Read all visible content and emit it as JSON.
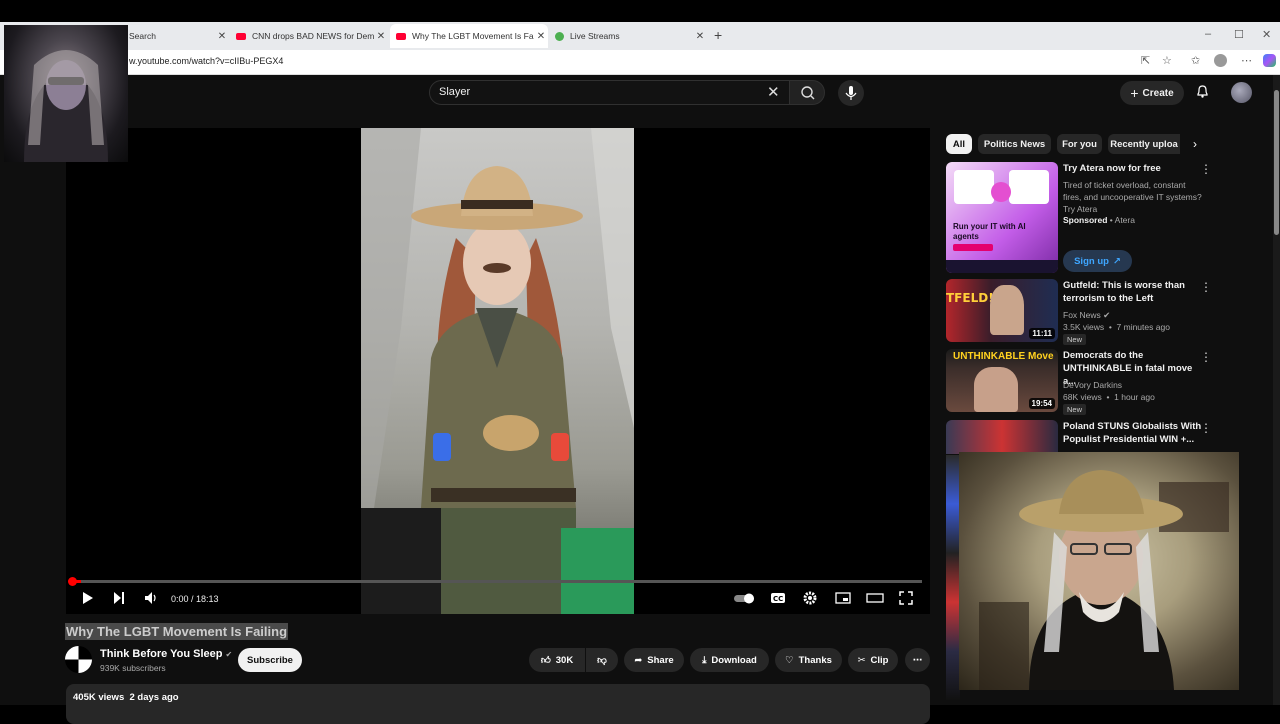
{
  "browser": {
    "tabs": [
      {
        "label": "Search",
        "color": "#888888"
      },
      {
        "label": "CNN drops BAD NEWS for Democ",
        "color": "#ff0033"
      },
      {
        "label": "Why The LGBT Movement Is Faili",
        "color": "#ff0033"
      },
      {
        "label": "Live Streams",
        "color": "#4caf50"
      }
    ],
    "url": "w.youtube.com/watch?v=cIIBu-PEGX4"
  },
  "header": {
    "search_value": "Slayer",
    "create_label": "Create"
  },
  "player": {
    "time": "0:00 / 18:13",
    "progress_fraction": 0.01
  },
  "video": {
    "title": "Why The LGBT Movement Is Failing",
    "channel": "Think Before You Sleep",
    "subscribers": "939K subscribers",
    "subscribe_label": "Subscribe",
    "likes": "30K",
    "share_label": "Share",
    "download_label": "Download",
    "thanks_label": "Thanks",
    "clip_label": "Clip",
    "views": "405K views  2 days ago"
  },
  "chips": [
    "All",
    "Politics News",
    "For you",
    "Recently uploa"
  ],
  "recommendations": [
    {
      "title": "Try Atera now for free",
      "desc": "Tired of ticket overload, constant fires, and uncooperative IT systems? Try Atera",
      "sponsor": "Sponsored",
      "advertiser": "Atera",
      "cta": "Sign up",
      "thumb_text": "Run your IT with AI agents"
    },
    {
      "title": "Gutfeld: This is worse than terrorism to the Left",
      "channel": "Fox News",
      "meta": "3.5K views  •  7 minutes ago",
      "badge": "New",
      "duration": "11:11"
    },
    {
      "title": "Democrats do the UNTHINKABLE in fatal move a...",
      "channel": "DeVory Darkins",
      "meta": "68K views  •  1 hour ago",
      "badge": "New",
      "duration": "19:54",
      "thumb_text": "UNTHINKABLE Move"
    },
    {
      "title": "Poland STUNS Globalists With Populist Presidential WIN +...",
      "channel": "",
      "meta": ""
    }
  ]
}
